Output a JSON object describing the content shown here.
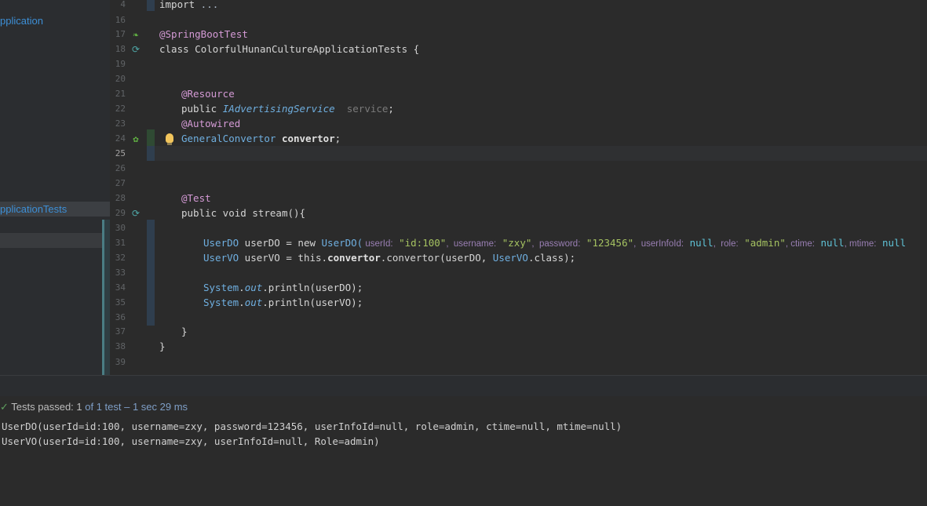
{
  "sidebar": {
    "items": [
      {
        "label": "pplication"
      },
      {
        "label": "pplicationTests"
      }
    ]
  },
  "gutter": {
    "line_numbers": [
      "4",
      "16",
      "17",
      "18",
      "19",
      "20",
      "21",
      "22",
      "23",
      "24",
      "25",
      "26",
      "27",
      "28",
      "29",
      "30",
      "31",
      "32",
      "33",
      "34",
      "35",
      "36",
      "37",
      "38",
      "39"
    ],
    "current_line": "25"
  },
  "code": {
    "l4": {
      "import_kw": "import",
      "rest": " ..."
    },
    "l17": {
      "anno": "@SpringBootTest"
    },
    "l18": {
      "kw": "class",
      "name": " ColorfulHunanCultureApplicationTests {"
    },
    "l21": {
      "anno": "@Resource"
    },
    "l22": {
      "kw": "public ",
      "type": "IAdvertisingService",
      "field": "  service",
      "semi": ";"
    },
    "l23": {
      "anno": "@Autowired"
    },
    "l24": {
      "type": "GeneralConvertor ",
      "field": "convertor",
      "semi": ";"
    },
    "l28": {
      "anno": "@Test"
    },
    "l29": {
      "kw": "public void ",
      "method": "stream",
      "rest": "(){"
    },
    "l31": {
      "type": "UserDO",
      "var": " userDO = ",
      "new_kw": "new ",
      "ctor": "UserDO(",
      "h1": " userId:",
      "v1": " \"id:100\"",
      "h2": ",  username:",
      "v2": " \"zxy\"",
      "h3": ",  password:",
      "v3": " \"123456\"",
      "h4": ",  userInfoId:",
      "v4": " null",
      "h5": ",  role:",
      "v5": " \"admin\"",
      "h6": ", ctime:",
      "v6": " null",
      "h7": ", mtime:",
      "v7": " null"
    },
    "l32": {
      "type": "UserVO",
      "var": " userVO = ",
      "this_kw": "this",
      "dot1": ".",
      "field": "convertor",
      "dot2": ".",
      "method": "convertor",
      "args1": "(userDO, ",
      "cls": "UserVO",
      "cls_kw": ".class",
      "end": ");"
    },
    "l34": {
      "sys": "System",
      "dot": ".",
      "out": "out",
      "dot2": ".",
      "method": "println",
      "args": "(userDO);"
    },
    "l35": {
      "sys": "System",
      "dot": ".",
      "out": "out",
      "dot2": ".",
      "method": "println",
      "args": "(userVO);"
    },
    "l37": {
      "brace": "}"
    },
    "l38": {
      "brace": "}"
    }
  },
  "run": {
    "status_prefix": "Tests passed: ",
    "passed_count": "1",
    "of_text": " of 1 test – 1 sec 29 ms",
    "console": [
      "UserDO(userId=id:100, username=zxy, password=123456, userInfoId=null, role=admin, ctime=null, mtime=null)",
      "UserVO(userId=id:100, username=zxy, userInfoId=null, Role=admin)"
    ]
  },
  "colors": {
    "background": "#2b2b2b",
    "annotation": "#d49ad5",
    "type": "#6fafe0",
    "string": "#a5c261",
    "pass": "#5fa05f"
  },
  "icons": [
    "spring-leaf-icon",
    "run-test-icon",
    "bean-icon",
    "lightbulb-icon",
    "check-icon"
  ]
}
